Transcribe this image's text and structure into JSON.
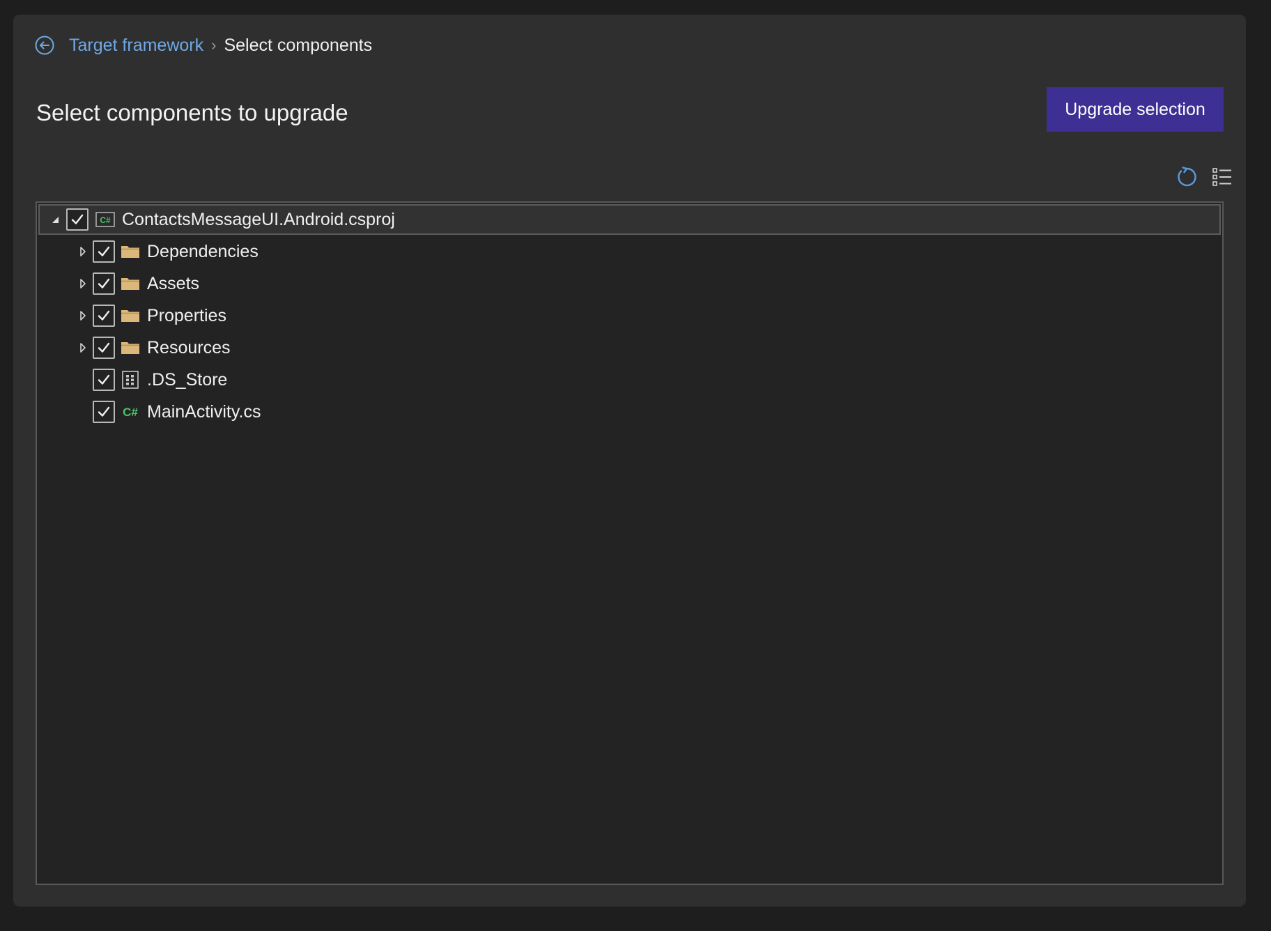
{
  "breadcrumb": {
    "back_icon": "arrow-circle-left-icon",
    "link_label": "Target framework",
    "separator": "›",
    "current_label": "Select components"
  },
  "page_title": "Select components to upgrade",
  "upgrade_button_label": "Upgrade selection",
  "toolbar": {
    "refresh_icon": "refresh-icon",
    "view_icon": "list-options-icon"
  },
  "tree": {
    "root": {
      "label": "ContactsMessageUI.Android.csproj",
      "icon": "csharp-project-icon",
      "checked": true,
      "expanded": true
    },
    "children": [
      {
        "label": "Dependencies",
        "icon": "folder-icon",
        "checked": true,
        "expandable": true
      },
      {
        "label": "Assets",
        "icon": "folder-icon",
        "checked": true,
        "expandable": true
      },
      {
        "label": "Properties",
        "icon": "folder-icon",
        "checked": true,
        "expandable": true
      },
      {
        "label": "Resources",
        "icon": "folder-icon",
        "checked": true,
        "expandable": true
      },
      {
        "label": ".DS_Store",
        "icon": "generic-file-icon",
        "checked": true,
        "expandable": false
      },
      {
        "label": "MainActivity.cs",
        "icon": "csharp-file-icon",
        "checked": true,
        "expandable": false
      }
    ]
  },
  "colors": {
    "accent_link": "#6fa8e6",
    "primary_button": "#3d2f93",
    "folder": "#dcb67a",
    "csharp": "#4ec36a"
  }
}
